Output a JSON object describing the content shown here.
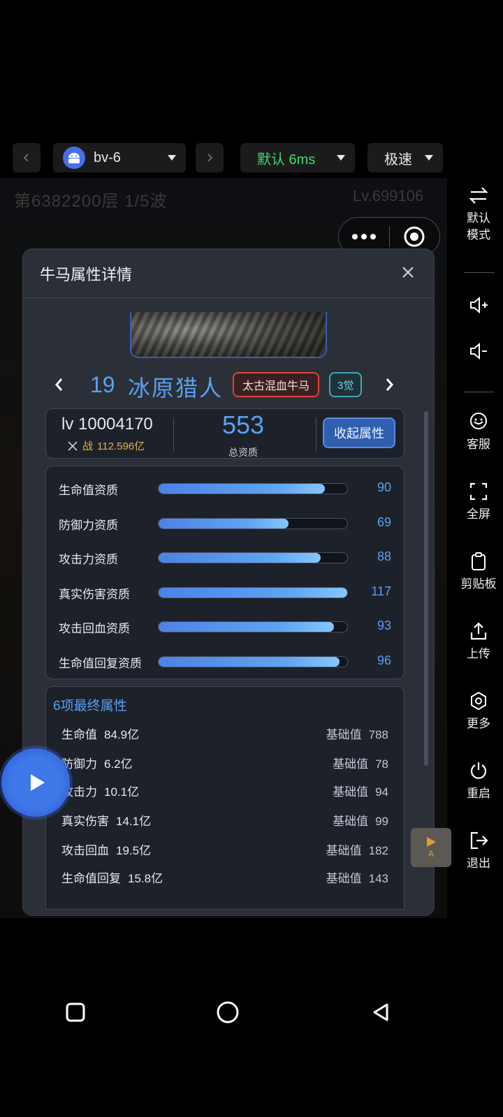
{
  "toolbar": {
    "device_name": "bv-6",
    "latency": "默认 6ms",
    "speed": "极速"
  },
  "background": {
    "title": "第6382200层  1/5波",
    "level": "Lv.699106"
  },
  "modal": {
    "title": "牛马属性详情",
    "hero": {
      "level": "19",
      "name": "冰原猎人",
      "tag_type": "太古混血牛马",
      "tag_awaken": "3觉"
    },
    "info": {
      "lv": "lv 10004170",
      "power_prefix": "战",
      "power": "112.596亿",
      "total_value": "553",
      "total_label": "总资质",
      "collapse_label": "收起属性"
    },
    "stats": [
      {
        "label": "生命值资质",
        "value": "90",
        "fill": 0.88
      },
      {
        "label": "防御力资质",
        "value": "69",
        "fill": 0.69
      },
      {
        "label": "攻击力资质",
        "value": "88",
        "fill": 0.86
      },
      {
        "label": "真实伤害资质",
        "value": "117",
        "fill": 1.0
      },
      {
        "label": "攻击回血资质",
        "value": "93",
        "fill": 0.93
      },
      {
        "label": "生命值回复资质",
        "value": "96",
        "fill": 0.96
      }
    ],
    "final": {
      "title": "6项最终属性",
      "base_label": "基础值",
      "rows": [
        {
          "name": "生命值",
          "value": "84.9亿",
          "base": "788"
        },
        {
          "name": "防御力",
          "value": "6.2亿",
          "base": "78"
        },
        {
          "name": "攻击力",
          "value": "10.1亿",
          "base": "94"
        },
        {
          "name": "真实伤害",
          "value": "14.1亿",
          "base": "99"
        },
        {
          "name": "攻击回血",
          "value": "19.5亿",
          "base": "182"
        },
        {
          "name": "生命值回复",
          "value": "15.8亿",
          "base": "143"
        }
      ]
    }
  },
  "auto_button": {
    "label": "A"
  },
  "side_panel": {
    "mode_line1": "默认",
    "mode_line2": "模式",
    "service": "客服",
    "fullscreen": "全屏",
    "clipboard": "剪贴板",
    "upload": "上传",
    "more": "更多",
    "restart": "重启",
    "exit": "退出"
  },
  "colors": {
    "accent": "#5aa0f2",
    "latency_green": "#3ddc6a",
    "tag_red": "#d9473d",
    "tag_teal": "#3fa7b9"
  }
}
